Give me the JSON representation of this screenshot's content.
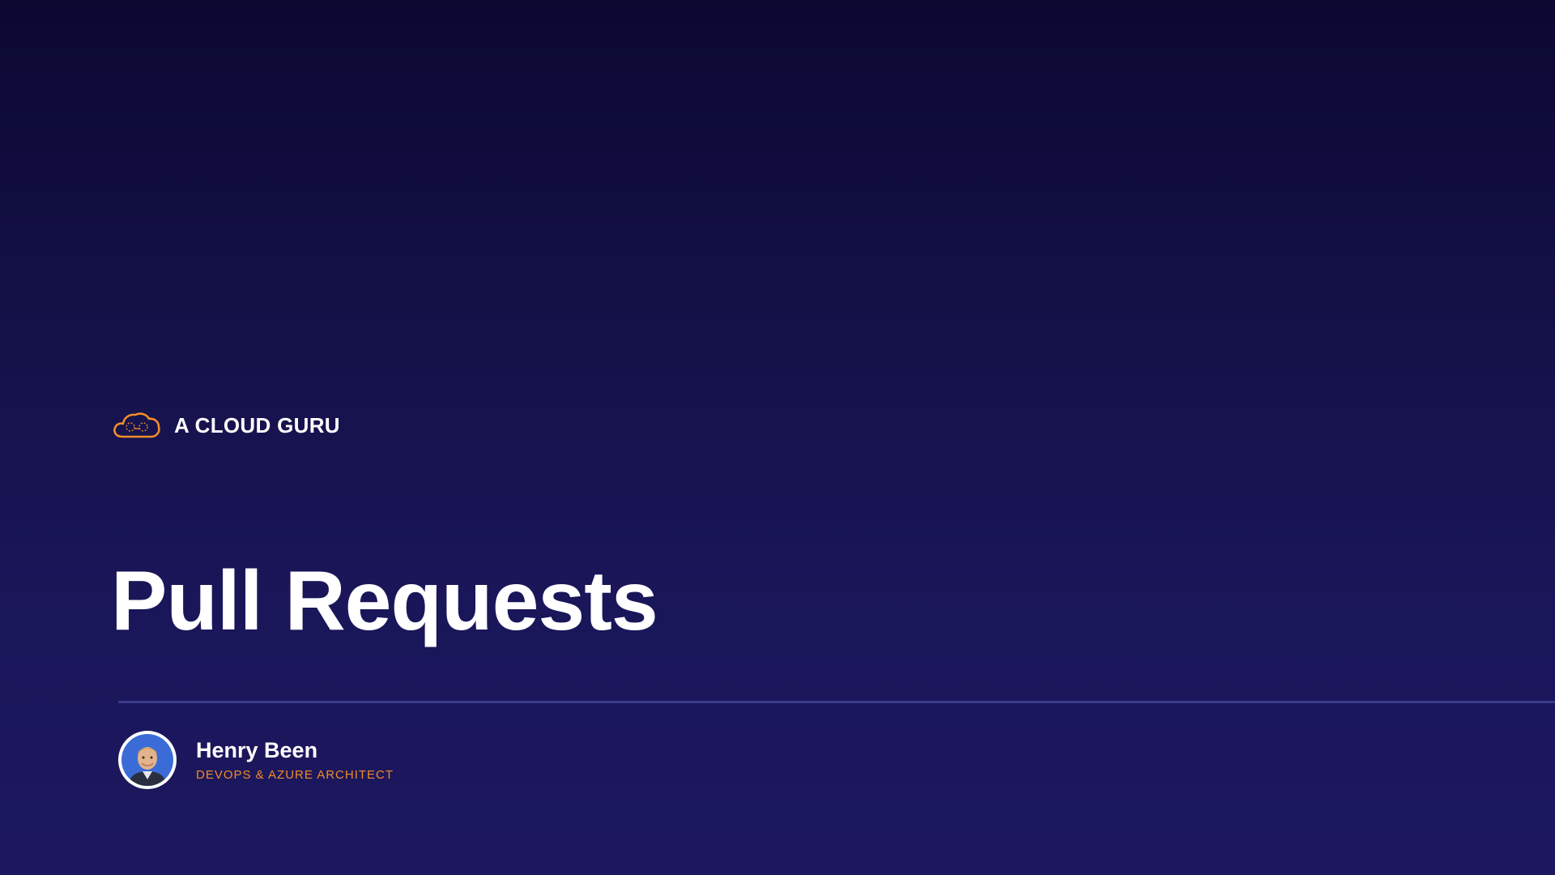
{
  "brand": {
    "name": "A CLOUD GURU",
    "logo_icon": "cloud-guru-logo-icon",
    "accent_color": "#f28c28"
  },
  "slide": {
    "title": "Pull Requests"
  },
  "presenter": {
    "name": "Henry Been",
    "role": "DEVOPS & AZURE ARCHITECT",
    "avatar_icon": "presenter-avatar"
  },
  "colors": {
    "background_top": "#0b0832",
    "background_bottom": "#1d185e",
    "divider": "#3a3a8a",
    "text": "#ffffff"
  }
}
